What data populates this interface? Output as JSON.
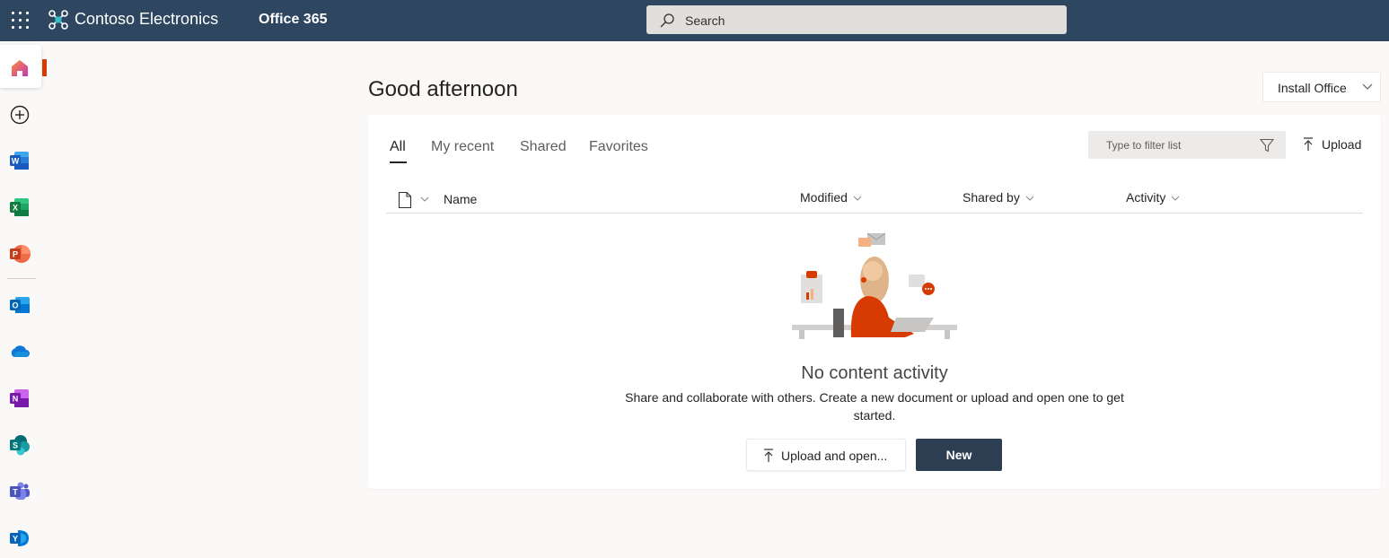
{
  "topbar": {
    "org_name": "Contoso Electronics",
    "suite_name": "Office 365",
    "search_placeholder": "Search",
    "background_color": "#2e4660"
  },
  "rail": {
    "items": [
      {
        "name": "home-icon",
        "selected": true
      },
      {
        "name": "create-icon"
      },
      {
        "name": "word-icon"
      },
      {
        "name": "excel-icon"
      },
      {
        "name": "powerpoint-icon"
      },
      {
        "name": "outlook-icon"
      },
      {
        "name": "onedrive-icon"
      },
      {
        "name": "onenote-icon"
      },
      {
        "name": "sharepoint-icon"
      },
      {
        "name": "teams-icon"
      },
      {
        "name": "yammer-icon"
      }
    ]
  },
  "main": {
    "greeting": "Good afternoon",
    "install_label": "Install Office",
    "tabs": [
      {
        "label": "All",
        "active": true
      },
      {
        "label": "My recent"
      },
      {
        "label": "Shared"
      },
      {
        "label": "Favorites"
      }
    ],
    "filter_placeholder": "Type to filter list",
    "upload_label": "Upload",
    "columns": [
      "Name",
      "Modified",
      "Shared by",
      "Activity"
    ],
    "empty_title": "No content activity",
    "empty_description": "Share and collaborate with others. Create a new document or upload and open one to get started.",
    "upload_open_label": "Upload and open...",
    "new_label": "New"
  },
  "colors": {
    "accent": "#d83b01",
    "primary_button": "#2e3e52"
  }
}
